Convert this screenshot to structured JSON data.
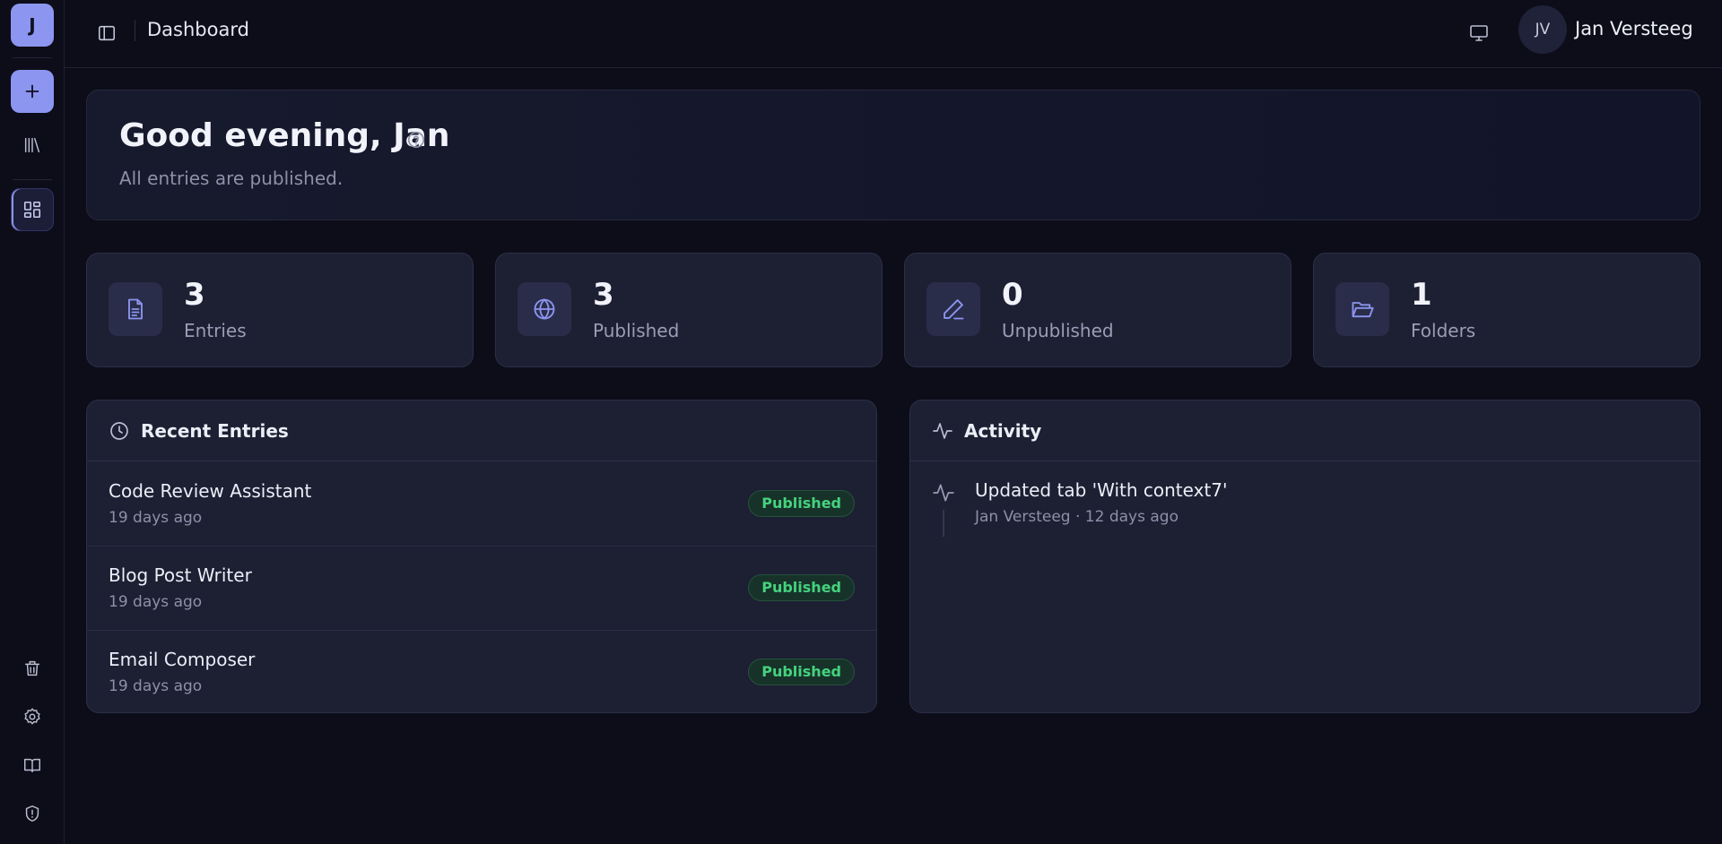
{
  "sidebar": {
    "logo_letter": "J",
    "new_icon": "plus-icon",
    "library_icon": "library-icon",
    "dashboard_icon": "dashboard-icon",
    "bottom_icons": [
      "trash-icon",
      "gear-icon",
      "book-icon",
      "shield-icon"
    ]
  },
  "topbar": {
    "toggle_icon": "sidebar-toggle-icon",
    "title": "Dashboard",
    "monitor_icon": "monitor-icon",
    "avatar_initials": "JV",
    "user_name": "Jan Versteeg"
  },
  "welcome": {
    "title": "Good evening, Jan",
    "subtitle": "All entries are published.",
    "help_icon": "help-circle-icon"
  },
  "stats": [
    {
      "value": "3",
      "label": "Entries",
      "icon": "document-icon"
    },
    {
      "value": "3",
      "label": "Published",
      "icon": "globe-icon"
    },
    {
      "value": "0",
      "label": "Unpublished",
      "icon": "pencil-icon"
    },
    {
      "value": "1",
      "label": "Folders",
      "icon": "folder-open-icon"
    }
  ],
  "recent": {
    "title": "Recent Entries",
    "icon": "clock-icon",
    "entries": [
      {
        "name": "Code Review Assistant",
        "time": "19 days ago",
        "status": "Published"
      },
      {
        "name": "Blog Post Writer",
        "time": "19 days ago",
        "status": "Published"
      },
      {
        "name": "Email Composer",
        "time": "19 days ago",
        "status": "Published"
      }
    ]
  },
  "activity": {
    "title": "Activity",
    "icon": "activity-icon",
    "items": [
      {
        "title": "Updated tab 'With context7'",
        "meta": "Jan Versteeg · 12 days ago"
      }
    ]
  },
  "colors": {
    "accent": "#8c95ef",
    "background": "#0c0d18",
    "card": "#1d1f33",
    "published_green": "#45d27e"
  }
}
